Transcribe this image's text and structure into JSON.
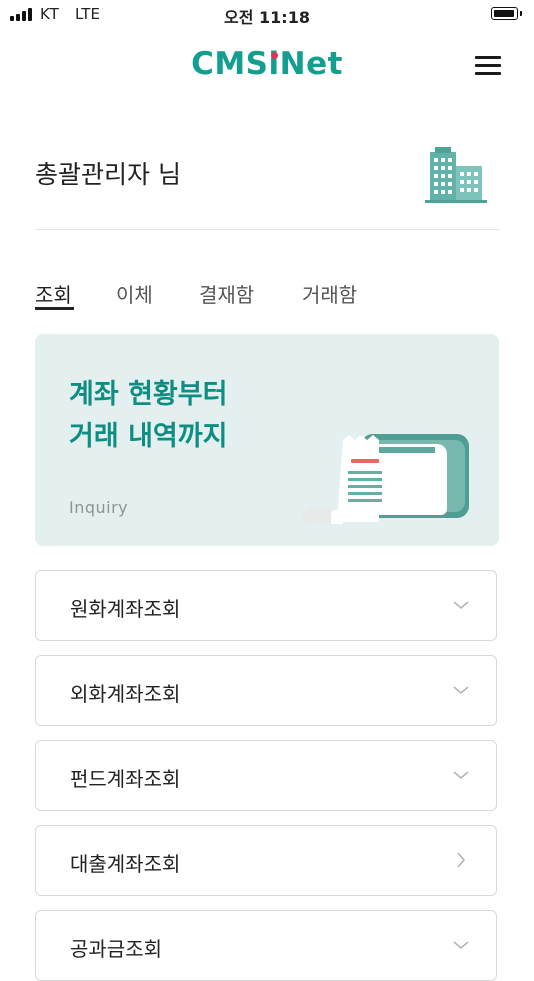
{
  "status_bar": {
    "carrier": "KT",
    "network": "LTE",
    "time": "오전 11:18"
  },
  "header": {
    "logo": "CMSiNet",
    "menu_icon": "hamburger-menu-icon"
  },
  "user": {
    "greeting": "총괄관리자 님",
    "icon": "building-icon"
  },
  "tabs": [
    {
      "label": "조회",
      "active": true
    },
    {
      "label": "이체",
      "active": false
    },
    {
      "label": "결재함",
      "active": false
    },
    {
      "label": "거래함",
      "active": false
    }
  ],
  "banner": {
    "line1": "계좌 현황부터",
    "line2": "거래 내역까지",
    "subtitle": "Inquiry",
    "icon": "receipt-wallet-icon"
  },
  "menu_items": [
    {
      "label": "원화계좌조회",
      "chevron": "down"
    },
    {
      "label": "외화계좌조회",
      "chevron": "down"
    },
    {
      "label": "펀드계좌조회",
      "chevron": "down"
    },
    {
      "label": "대출계좌조회",
      "chevron": "right"
    },
    {
      "label": "공과금조회",
      "chevron": "down"
    }
  ],
  "colors": {
    "brand": "#139f90",
    "banner_bg": "#e3f0ef",
    "banner_text": "#0e8e82",
    "logo_accent": "#e0325a"
  }
}
